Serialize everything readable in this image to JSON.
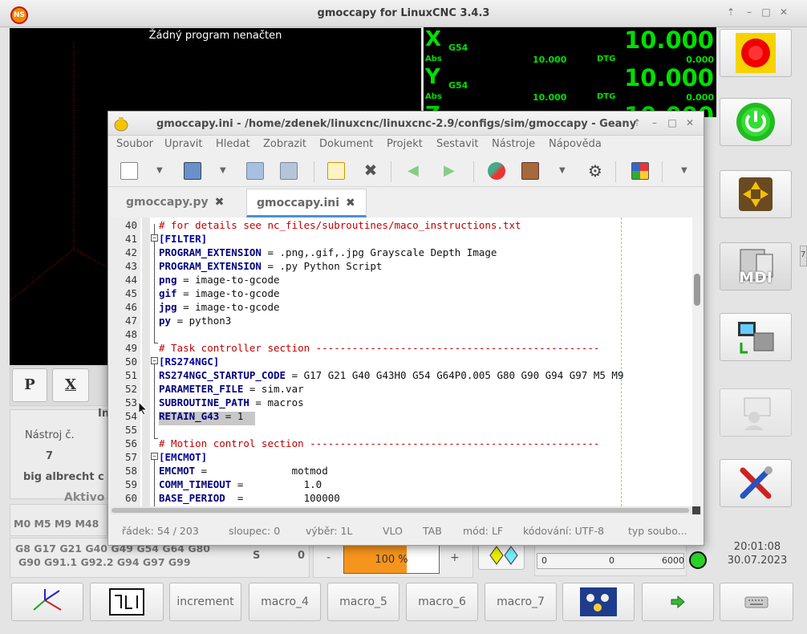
{
  "window": {
    "title": "gmoccapy for LinuxCNC  3.4.3",
    "logo_text": "NS"
  },
  "preview": {
    "message": "Žádný program nenačten",
    "view_buttons": [
      "P",
      "X"
    ]
  },
  "dro": {
    "axes": [
      {
        "axis": "X",
        "coord": "G54",
        "value": "10.000",
        "abs_label": "Abs",
        "abs": "10.000",
        "dtg_label": "DTG",
        "dtg": "0.000"
      },
      {
        "axis": "Y",
        "coord": "G54",
        "value": "10.000",
        "abs_label": "Abs",
        "abs": "10.000",
        "dtg_label": "DTG",
        "dtg": "0.000"
      },
      {
        "axis": "Z",
        "coord": "",
        "value": "10.000",
        "abs_label": "",
        "abs": "",
        "dtg_label": "",
        "dtg": ""
      }
    ]
  },
  "right_buttons": {
    "mdi_label": "MDI",
    "side_tab": "7"
  },
  "tool_panel": {
    "header": "In",
    "tool_no_label": "Nástroj č.",
    "tool_no": "7",
    "tool_desc": "big albrecht c",
    "active_label": "Aktivo"
  },
  "gcodes": {
    "mcodes": "M0 M5 M9 M48",
    "line1": "G8 G17 G21 G40 G49 G54 G64 G80",
    "line2": "G90 G91.1 G92.2 G94 G97 G99"
  },
  "spindle": {
    "s_label": "S",
    "s_value": "0",
    "minus": "-",
    "plus": "+",
    "override": "100 %",
    "override_percent": 100
  },
  "spindle_bar": {
    "min": "0",
    "mid": "0",
    "max": "6000"
  },
  "clock": {
    "time": "20:01:08",
    "date": "30.07.2023"
  },
  "bottom_buttons": [
    "increment",
    "macro_4",
    "macro_5",
    "macro_6",
    "macro_7"
  ],
  "geany": {
    "title": "gmoccapy.ini - /home/zdenek/linuxcnc/linuxcnc-2.9/configs/sim/gmoccapy - Geany",
    "menu": [
      "Soubor",
      "Upravit",
      "Hledat",
      "Zobrazit",
      "Dokument",
      "Projekt",
      "Sestavit",
      "Nástroje",
      "Nápověda"
    ],
    "tabs": [
      {
        "label": "gmoccapy.py",
        "close": "✖"
      },
      {
        "label": "gmoccapy.ini",
        "close": "✖"
      }
    ],
    "lines": [
      {
        "n": "40",
        "t": "# for details see nc_files/subroutines/maco_instructions.txt"
      },
      {
        "n": "41",
        "t": "[FILTER]"
      },
      {
        "n": "42",
        "k": "PROGRAM_EXTENSION",
        "t": " = .png,.gif,.jpg Grayscale Depth Image"
      },
      {
        "n": "43",
        "k": "PROGRAM_EXTENSION",
        "t": " = .py Python Script"
      },
      {
        "n": "44",
        "k": "png",
        "t": " = image-to-gcode"
      },
      {
        "n": "45",
        "k": "gif",
        "t": " = image-to-gcode"
      },
      {
        "n": "46",
        "k": "jpg",
        "t": " = image-to-gcode"
      },
      {
        "n": "47",
        "k": "py",
        "t": " = python3"
      },
      {
        "n": "48",
        "t": ""
      },
      {
        "n": "49",
        "t": "# Task controller section -----------------------------------------------"
      },
      {
        "n": "50",
        "t": "[RS274NGC]"
      },
      {
        "n": "51",
        "k": "RS274NGC_STARTUP_CODE",
        "t": " = G17 G21 G40 G43H0 G54 G64P0.005 G80 G90 G94 G97 M5 M9"
      },
      {
        "n": "52",
        "k": "PARAMETER_FILE",
        "t": " = sim.var"
      },
      {
        "n": "53",
        "k": "SUBROUTINE_PATH",
        "t": " = macros"
      },
      {
        "n": "54",
        "k": "RETAIN_G43",
        "t": " = 1"
      },
      {
        "n": "55",
        "t": ""
      },
      {
        "n": "56",
        "t": "# Motion control section ------------------------------------------------"
      },
      {
        "n": "57",
        "t": "[EMCMOT]"
      },
      {
        "n": "58",
        "k": "EMCMOT",
        "t": " =              motmod"
      },
      {
        "n": "59",
        "k": "COMM_TIMEOUT",
        "t": " =          1.0"
      },
      {
        "n": "60",
        "k": "BASE_PERIOD",
        "t": "  =          100000"
      }
    ],
    "status": {
      "line": "řádek: 54 / 203",
      "col": "sloupec: 0",
      "sel": "výběr: 1L",
      "ins": "VLO",
      "tab": "TAB",
      "mode": "mód: LF",
      "enc": "kódování: UTF-8",
      "type": "typ soubo..."
    }
  }
}
